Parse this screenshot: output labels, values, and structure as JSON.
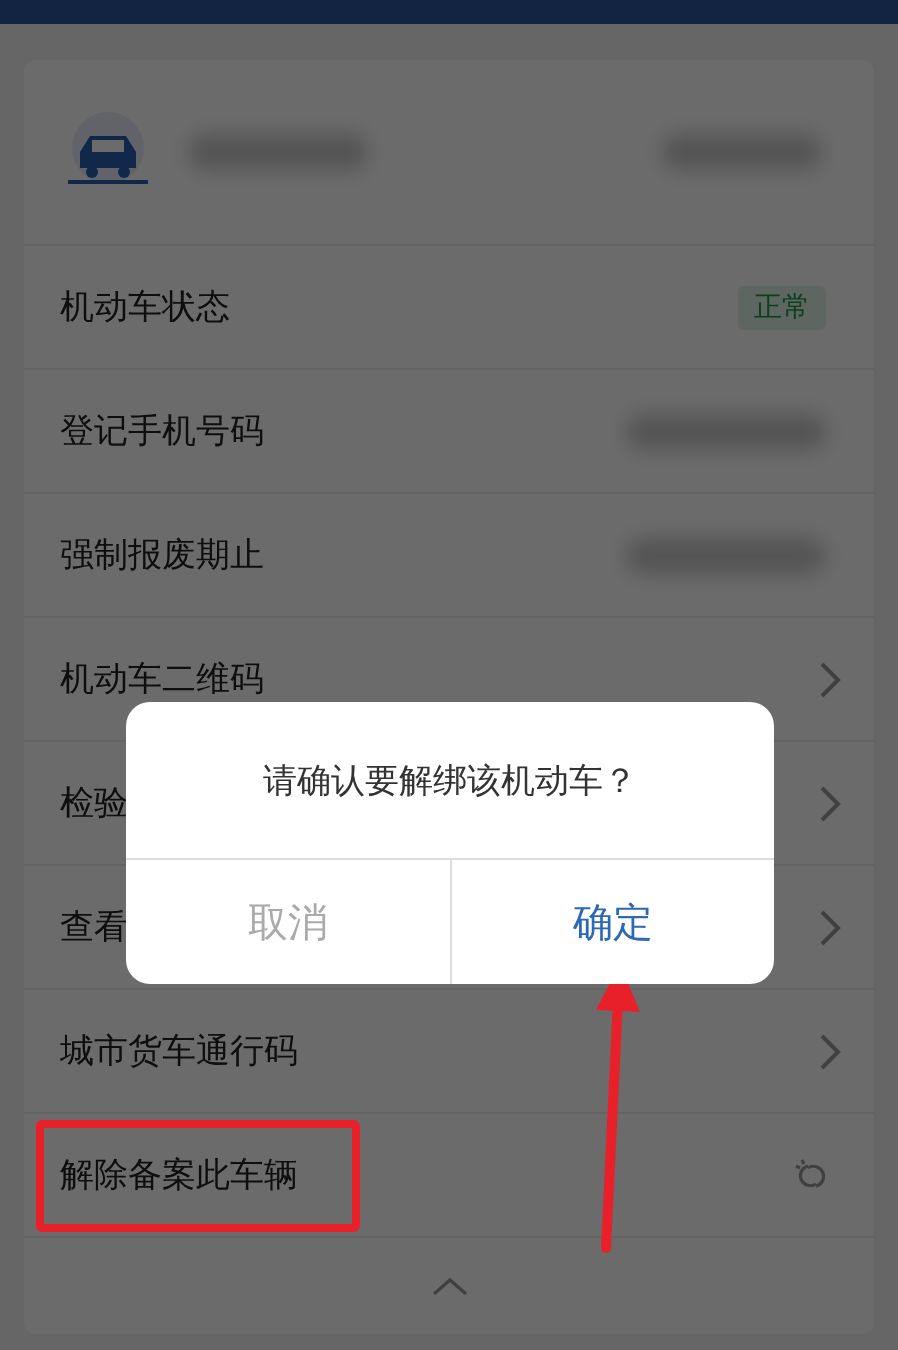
{
  "rows": [
    {
      "label": "机动车状态",
      "kind": "badge",
      "value": "正常"
    },
    {
      "label": "登记手机号码",
      "kind": "blurred"
    },
    {
      "label": "强制报废期止",
      "kind": "blurred"
    },
    {
      "label": "机动车二维码",
      "kind": "link"
    },
    {
      "label": "检验",
      "kind": "link"
    },
    {
      "label": "查看",
      "kind": "link"
    },
    {
      "label": "城市货车通行码",
      "kind": "link"
    },
    {
      "label": "解除备案此车辆",
      "kind": "unlink"
    }
  ],
  "dialog": {
    "message": "请确认要解绑该机动车？",
    "buttons": [
      {
        "label": "取消",
        "kind": "cancel"
      },
      {
        "label": "确定",
        "kind": "confirm"
      }
    ]
  }
}
